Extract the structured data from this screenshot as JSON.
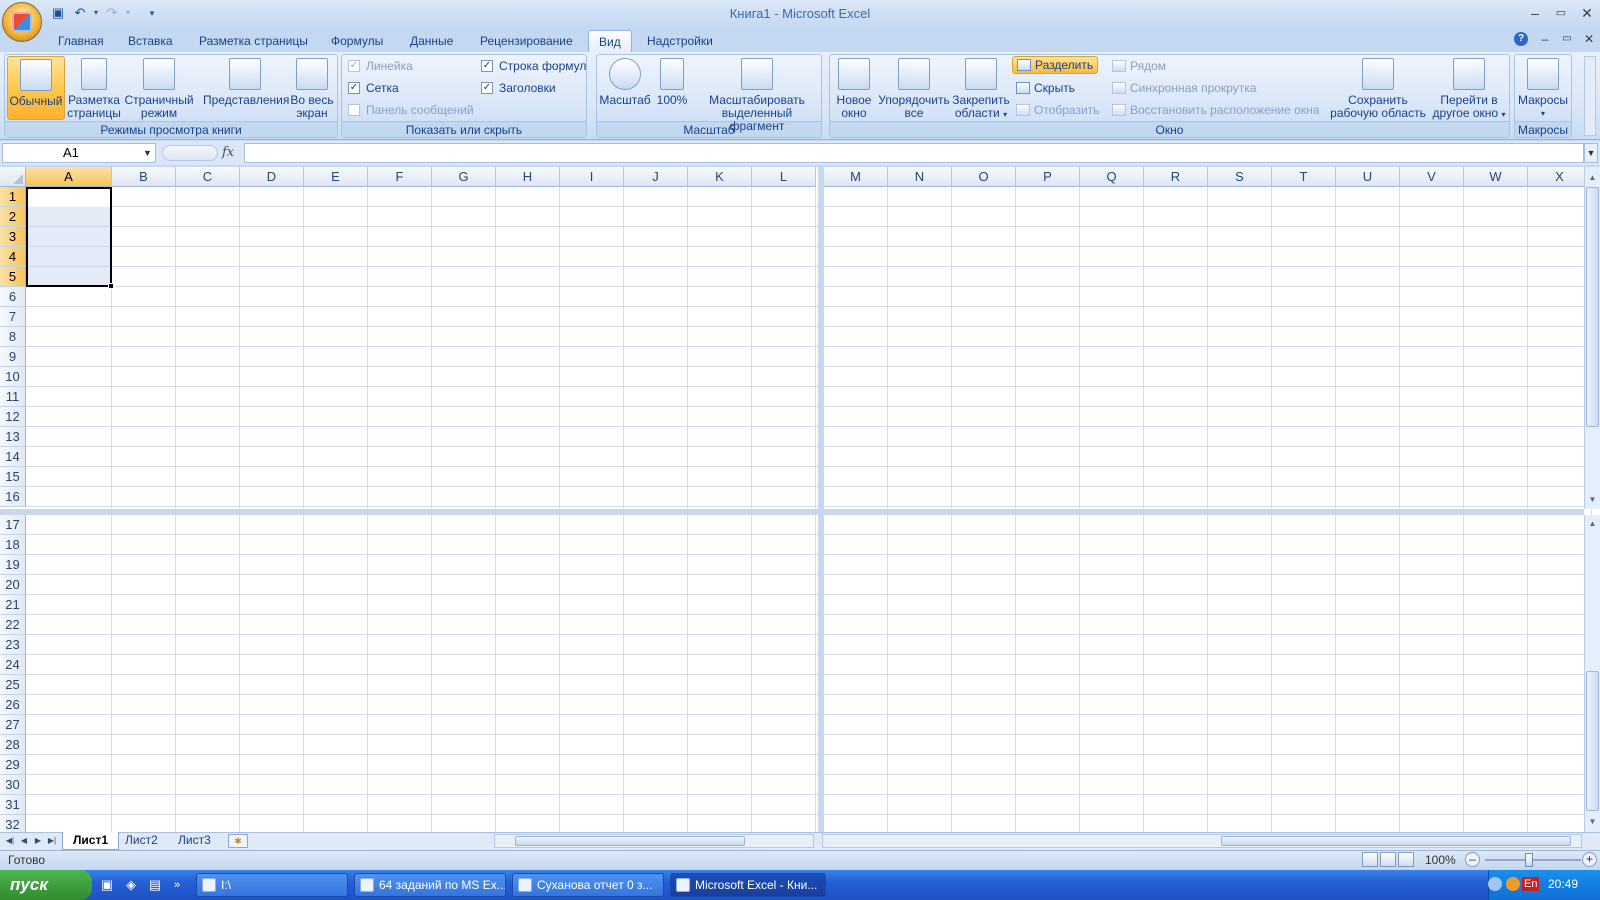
{
  "window": {
    "title": "Книга1 - Microsoft Excel",
    "controls": [
      "–",
      "▭",
      "✕"
    ],
    "inner_controls": [
      "–",
      "▭",
      "✕"
    ]
  },
  "qat": [
    "save-icon",
    "undo-icon",
    "redo-icon",
    "customize-icon"
  ],
  "tabs": [
    "Главная",
    "Вставка",
    "Разметка страницы",
    "Формулы",
    "Данные",
    "Рецензирование",
    "Вид",
    "Надстройки"
  ],
  "active_tab": "Вид",
  "ribbon": {
    "views": {
      "label": "Режимы просмотра книги",
      "normal": "Обычный",
      "page_layout_1": "Разметка",
      "page_layout_2": "страницы",
      "page_break_1": "Страничный",
      "page_break_2": "режим",
      "custom": "Представления",
      "full_1": "Во весь",
      "full_2": "экран"
    },
    "show": {
      "label": "Показать или скрыть",
      "ruler": "Линейка",
      "gridlines": "Сетка",
      "message_bar": "Панель сообщений",
      "formula_bar": "Строка формул",
      "headings": "Заголовки"
    },
    "zoom": {
      "label": "Масштаб",
      "zoom_btn": "Масштаб",
      "hundred": "100%",
      "sel_1": "Масштабировать",
      "sel_2": "выделенный фрагмент"
    },
    "window": {
      "label": "Окно",
      "new_1": "Новое",
      "new_2": "окно",
      "arrange_1": "Упорядочить",
      "arrange_2": "все",
      "freeze_1": "Закрепить",
      "freeze_2": "области",
      "split": "Разделить",
      "hide": "Скрыть",
      "unhide": "Отобразить",
      "side": "Рядом",
      "sync": "Синхронная прокрутка",
      "reset": "Восстановить расположение окна",
      "save_1": "Сохранить",
      "save_2": "рабочую область",
      "switch_1": "Перейти в",
      "switch_2": "другое окно"
    },
    "macros": {
      "label": "Макросы",
      "btn": "Макросы"
    }
  },
  "formula_bar": {
    "name_box": "A1",
    "fx": "fx",
    "value": ""
  },
  "columns_left": [
    "A",
    "B",
    "C",
    "D",
    "E",
    "F",
    "G",
    "H",
    "I",
    "J",
    "K",
    "L"
  ],
  "columns_right": [
    "M",
    "N",
    "O",
    "P",
    "Q",
    "R",
    "S",
    "T",
    "U",
    "V",
    "W",
    "X"
  ],
  "rows_top": [
    "1",
    "2",
    "3",
    "4",
    "5",
    "6",
    "7",
    "8",
    "9",
    "10",
    "11",
    "12",
    "13",
    "14",
    "15",
    "16"
  ],
  "rows_bottom": [
    "17",
    "18",
    "19",
    "20",
    "21",
    "22",
    "23",
    "24",
    "25",
    "26",
    "27",
    "28",
    "29",
    "30",
    "31",
    "32"
  ],
  "sheets": [
    "Лист1",
    "Лист2",
    "Лист3"
  ],
  "active_sheet": "Лист1",
  "status": {
    "text": "Готово",
    "zoom": "100%"
  },
  "taskbar": {
    "start": "пуск",
    "items": [
      "I:\\",
      "64 заданий по MS Ex...",
      "Суханова отчет 0 з...",
      "Microsoft Excel - Кни..."
    ],
    "active_item": "Microsoft Excel - Кни...",
    "lang": "En",
    "clock": "20:49"
  }
}
